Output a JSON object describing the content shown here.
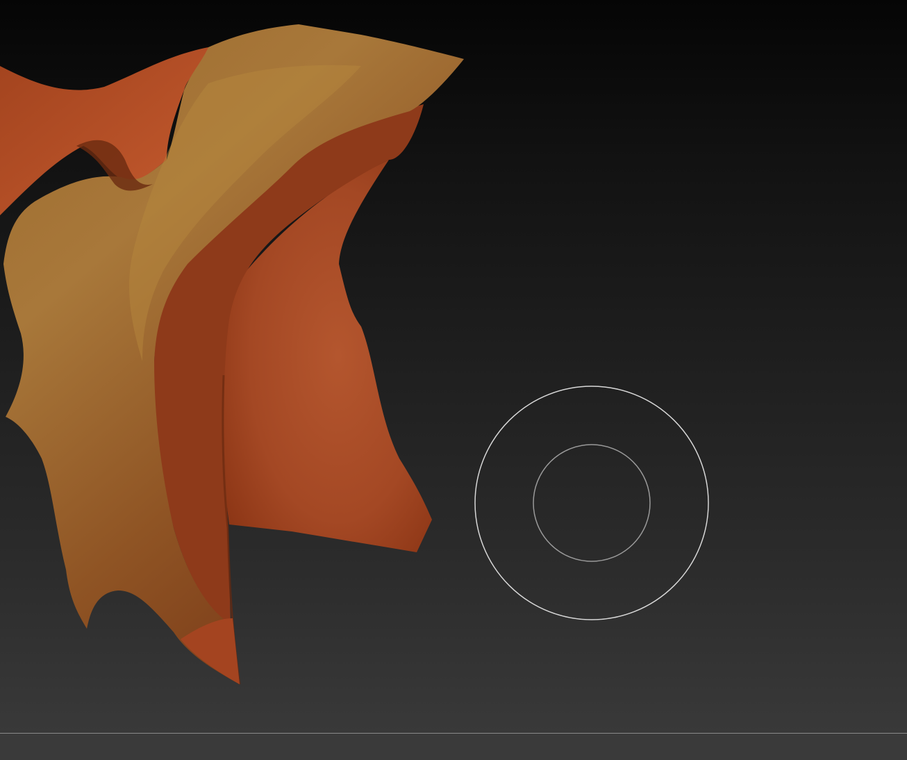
{
  "viewport": {
    "background_top": "#050505",
    "background_bottom": "#393939",
    "model": {
      "name": "sculpted-mesh",
      "colors": {
        "front_highlight": "#b8893f",
        "front_mid": "#9a6428",
        "front_shadow": "#7a3f18",
        "back_light": "#c0653a",
        "back_dark": "#8a3416",
        "edge": "#b84a22"
      }
    },
    "brush_cursor": {
      "outer_color": "#d8d8d8",
      "inner_color": "#9a9a9a"
    }
  },
  "bottom_shelf": {
    "divider_color": "#8a8a8a",
    "background": "#3a3a3a"
  }
}
